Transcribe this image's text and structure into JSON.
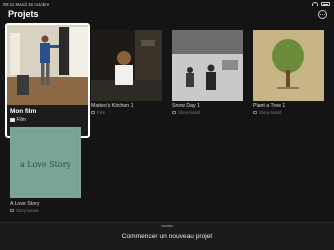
{
  "status_bar": {
    "time_date": "09:41  Mardi 16 octobre"
  },
  "header": {
    "title": "Projets"
  },
  "projects": [
    {
      "title": "Mon film",
      "subtitle": "Film"
    },
    {
      "title": "Matteo's Kitchen 1",
      "subtitle": "Film"
    },
    {
      "title": "Snow Day 1",
      "subtitle": "Story-board"
    },
    {
      "title": "Plant a Tree 1",
      "subtitle": "Story-board"
    },
    {
      "title": "A Love Story",
      "subtitle": "Story-board",
      "thumbnail_text": "a Love Story"
    }
  ],
  "footer": {
    "new_project_label": "Commencer un nouveau projet"
  },
  "colors": {
    "background": "#141414",
    "love_story_teal": "#7aa597",
    "plant_tree_tan": "#c7b487",
    "tree_green": "#6b8b3a"
  }
}
